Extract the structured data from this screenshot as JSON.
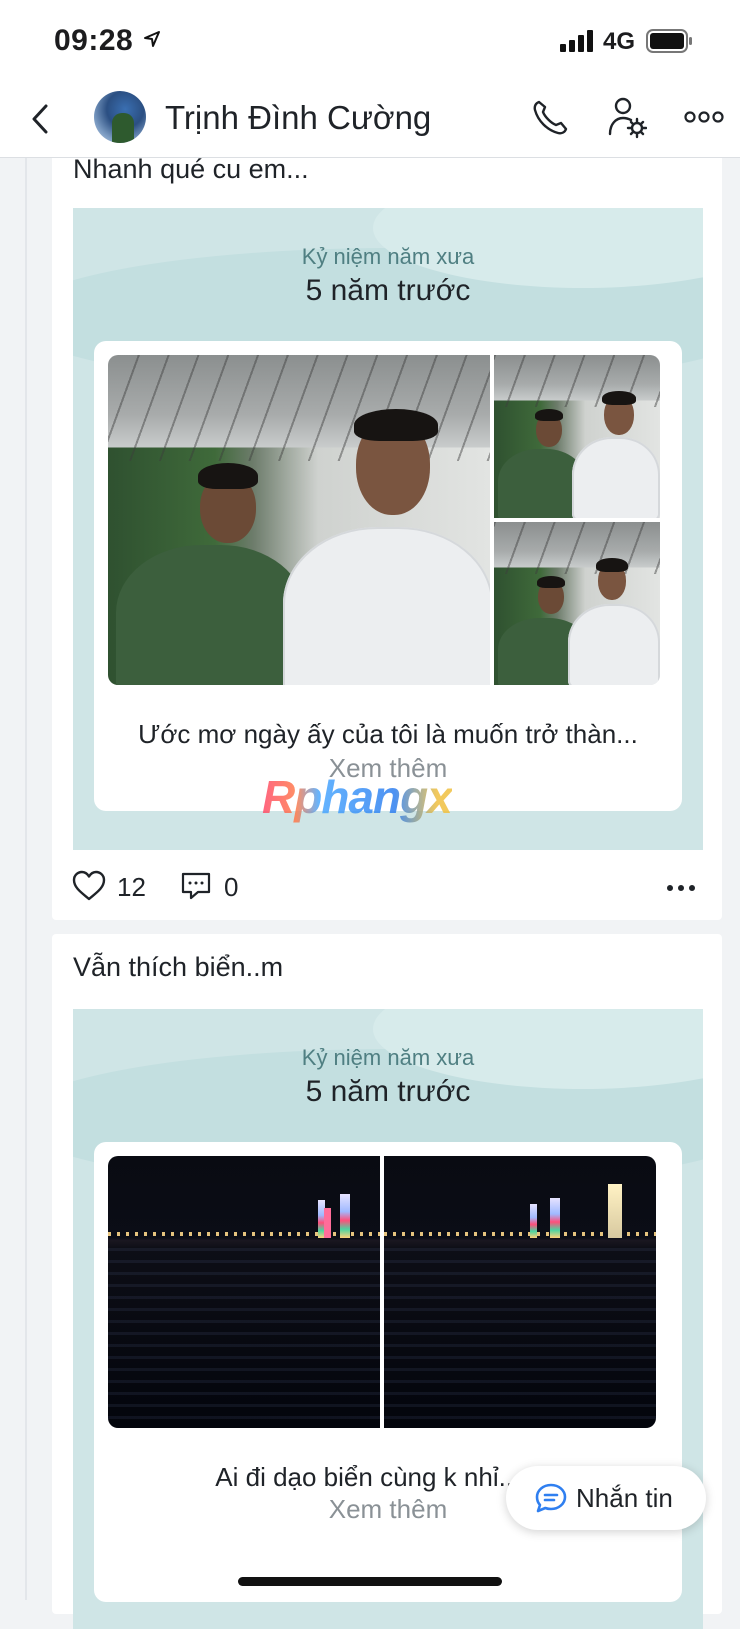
{
  "status_bar": {
    "time": "09:28",
    "network": "4G"
  },
  "header": {
    "name": "Trịnh Đình Cường"
  },
  "posts": [
    {
      "text": "Nhanh qué cu em...",
      "memory_label": "Kỷ niệm năm xưa",
      "memory_years": "5 năm trước",
      "caption": "Ước mơ ngày ấy của tôi là muốn trở thàn...",
      "see_more": "Xem thêm",
      "likes": "12",
      "comments": "0"
    },
    {
      "text": "Vẫn thích biển..m",
      "memory_label": "Kỷ niệm năm xưa",
      "memory_years": "5 năm trước",
      "caption": "Ai đi dạo biển cùng k nhỉ......H",
      "see_more": "Xem thêm"
    }
  ],
  "watermark": "Rphangx",
  "chat_button": {
    "label": "Nhắn tin"
  },
  "colors": {
    "memory_bg": "#cfe5e6",
    "accent": "#2f7ff0",
    "muted": "#8a9196"
  }
}
